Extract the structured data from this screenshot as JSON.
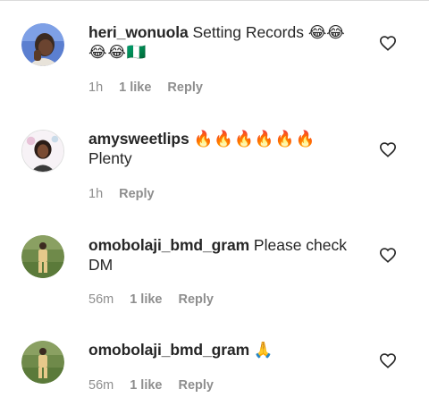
{
  "comments": [
    {
      "username": "heri_wonuola",
      "text_line1": "Setting Records 😂😂",
      "text_line2": "😂😂🇳🇬",
      "time": "1h",
      "likes": "1 like",
      "reply": "Reply",
      "avatar_icon": "avatar-photo"
    },
    {
      "username": "amysweetlips",
      "text_line1": "🔥🔥🔥🔥🔥🔥",
      "text_line2": "Plenty",
      "time": "1h",
      "likes": "",
      "reply": "Reply",
      "avatar_icon": "avatar-photo"
    },
    {
      "username": "omobolaji_bmd_gram",
      "text_line1": "Please check",
      "text_line2": "DM",
      "time": "56m",
      "likes": "1 like",
      "reply": "Reply",
      "avatar_icon": "avatar-photo"
    },
    {
      "username": "omobolaji_bmd_gram",
      "text_line1": "🙏",
      "text_line2": "",
      "time": "56m",
      "likes": "1 like",
      "reply": "Reply",
      "avatar_icon": "avatar-photo"
    }
  ],
  "icons": {
    "like": "heart-outline-icon"
  },
  "colors": {
    "text": "#262626",
    "meta": "#8e8e8e",
    "divider": "#dbdbdb"
  }
}
